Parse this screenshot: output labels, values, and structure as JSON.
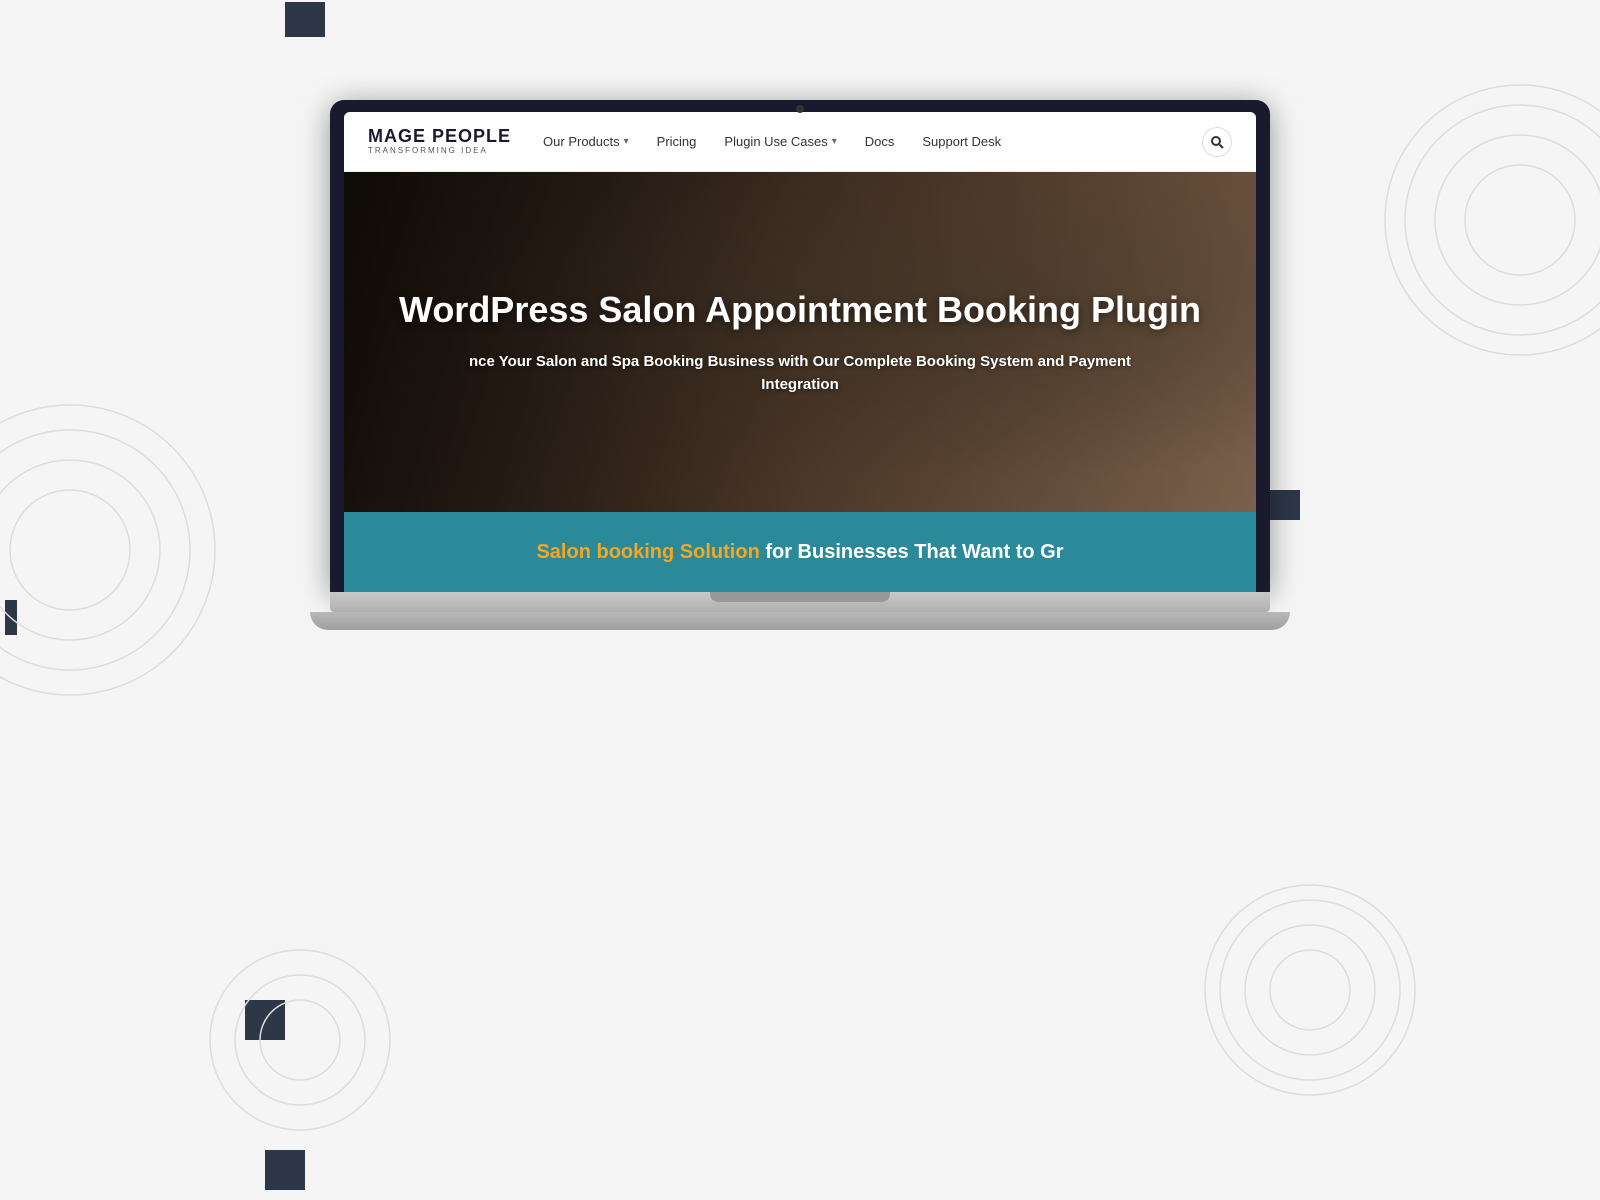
{
  "background": {
    "color": "#f5f5f5"
  },
  "nav": {
    "logo": {
      "main": "MAGE PEOPLE",
      "sub": "TRANSFORMING IDEA"
    },
    "links": [
      {
        "label": "Our Products",
        "hasDropdown": true
      },
      {
        "label": "Pricing",
        "hasDropdown": false
      },
      {
        "label": "Plugin Use Cases",
        "hasDropdown": true
      },
      {
        "label": "Docs",
        "hasDropdown": false
      },
      {
        "label": "Support Desk",
        "hasDropdown": false
      }
    ],
    "searchAriaLabel": "Search"
  },
  "hero": {
    "title": "WordPress Salon Appointment Booking Plugin",
    "subtitle": "nce Your Salon and Spa Booking Business with Our Complete Booking System and Payment Integration",
    "bottom_text_highlight": "Salon booking Solution",
    "bottom_text_rest": " for Businesses That Want to Gr"
  }
}
